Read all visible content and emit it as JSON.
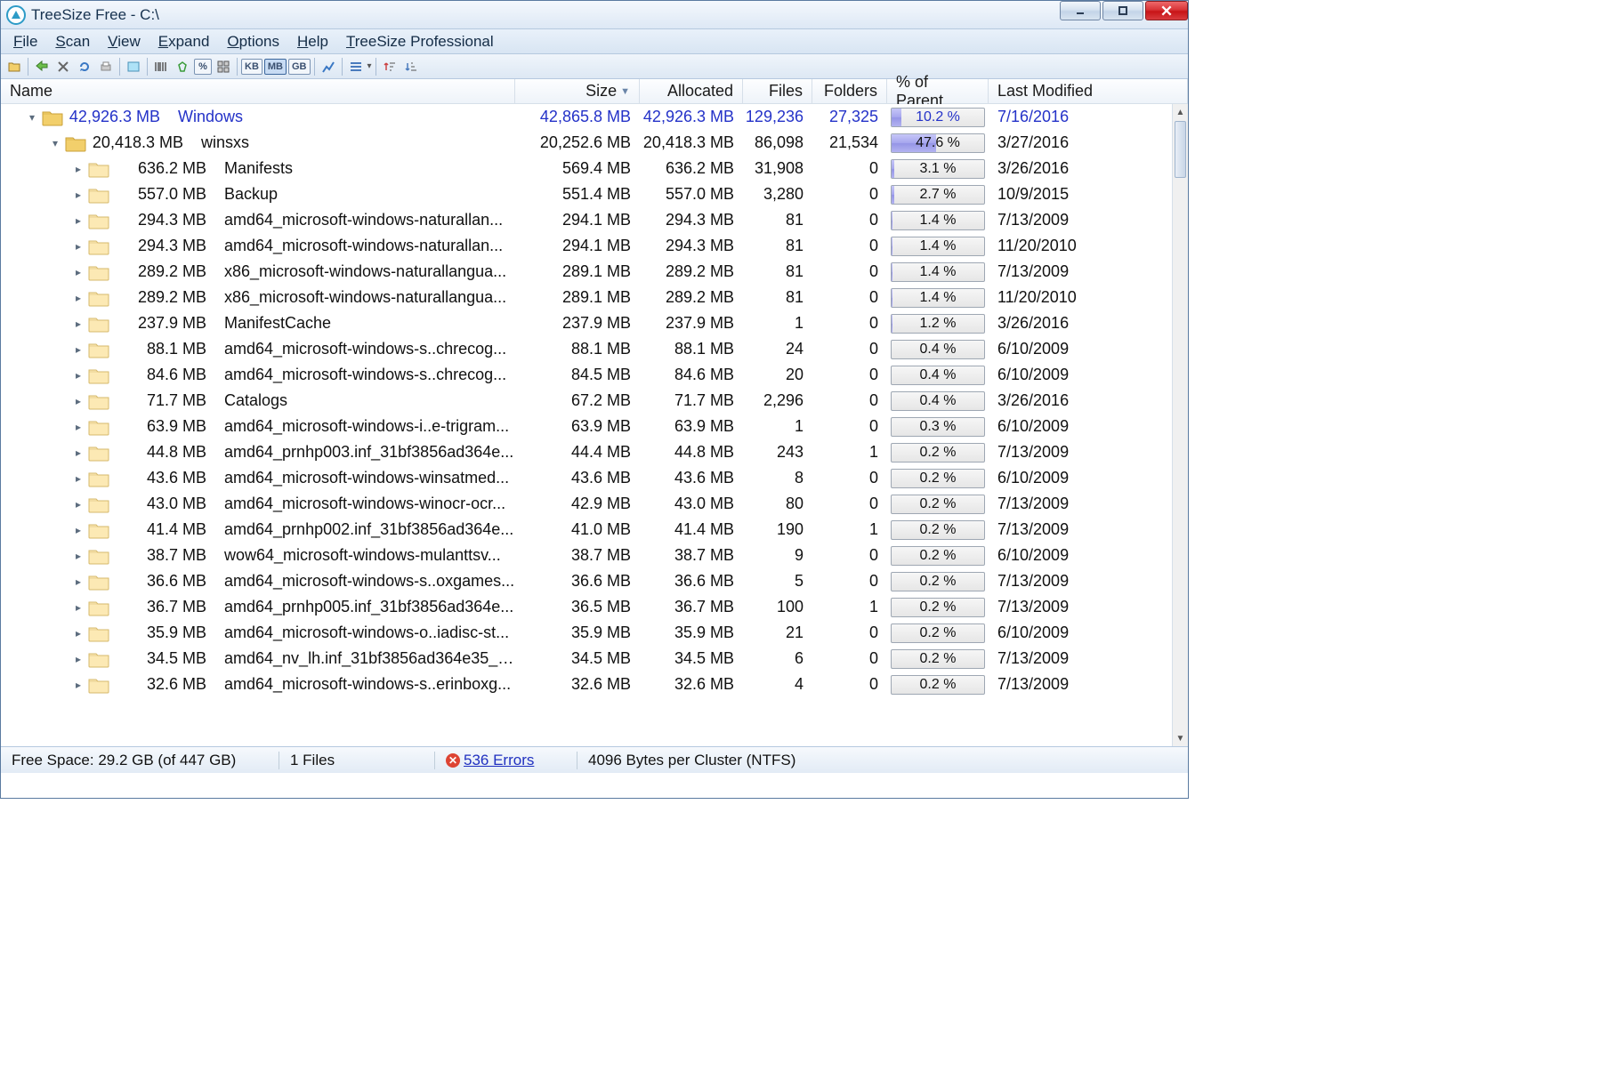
{
  "window": {
    "title": "TreeSize Free - C:\\"
  },
  "menu": {
    "items": [
      {
        "label": "File",
        "u": "F"
      },
      {
        "label": "Scan",
        "u": "S"
      },
      {
        "label": "View",
        "u": "V"
      },
      {
        "label": "Expand",
        "u": "E"
      },
      {
        "label": "Options",
        "u": "O"
      },
      {
        "label": "Help",
        "u": "H"
      },
      {
        "label": "TreeSize Professional",
        "u": "T"
      }
    ]
  },
  "toolbar": {
    "units": [
      {
        "label": "KB",
        "active": false
      },
      {
        "label": "MB",
        "active": true
      },
      {
        "label": "GB",
        "active": false
      }
    ],
    "pct_label": "%"
  },
  "columns": {
    "name": "Name",
    "size": "Size",
    "allocated": "Allocated",
    "files": "Files",
    "folders": "Folders",
    "pct": "% of Parent...",
    "modified": "Last Modified"
  },
  "rows": [
    {
      "indent": 28,
      "exp": "▾",
      "gold": true,
      "blue": true,
      "sizeL": "42,926.3 MB",
      "name": "Windows",
      "size": "42,865.8 MB",
      "alloc": "42,926.3 MB",
      "files": "129,236",
      "fold": "27,325",
      "pct": "10.2 %",
      "pctv": 10.2,
      "mod": "7/16/2016"
    },
    {
      "indent": 54,
      "exp": "▾",
      "gold": true,
      "blue": false,
      "sizeL": "20,418.3 MB",
      "name": "winsxs",
      "size": "20,252.6 MB",
      "alloc": "20,418.3 MB",
      "files": "86,098",
      "fold": "21,534",
      "pct": "47.6 %",
      "pctv": 47.6,
      "mod": "3/27/2016"
    },
    {
      "indent": 80,
      "exp": "▸",
      "gold": false,
      "blue": false,
      "sizeL": "636.2 MB",
      "name": "Manifests",
      "size": "569.4 MB",
      "alloc": "636.2 MB",
      "files": "31,908",
      "fold": "0",
      "pct": "3.1 %",
      "pctv": 3.1,
      "mod": "3/26/2016"
    },
    {
      "indent": 80,
      "exp": "▸",
      "gold": false,
      "blue": false,
      "sizeL": "557.0 MB",
      "name": "Backup",
      "size": "551.4 MB",
      "alloc": "557.0 MB",
      "files": "3,280",
      "fold": "0",
      "pct": "2.7 %",
      "pctv": 2.7,
      "mod": "10/9/2015"
    },
    {
      "indent": 80,
      "exp": "▸",
      "gold": false,
      "blue": false,
      "sizeL": "294.3 MB",
      "name": "amd64_microsoft-windows-naturallan...",
      "size": "294.1 MB",
      "alloc": "294.3 MB",
      "files": "81",
      "fold": "0",
      "pct": "1.4 %",
      "pctv": 1.4,
      "mod": "7/13/2009"
    },
    {
      "indent": 80,
      "exp": "▸",
      "gold": false,
      "blue": false,
      "sizeL": "294.3 MB",
      "name": "amd64_microsoft-windows-naturallan...",
      "size": "294.1 MB",
      "alloc": "294.3 MB",
      "files": "81",
      "fold": "0",
      "pct": "1.4 %",
      "pctv": 1.4,
      "mod": "11/20/2010"
    },
    {
      "indent": 80,
      "exp": "▸",
      "gold": false,
      "blue": false,
      "sizeL": "289.2 MB",
      "name": "x86_microsoft-windows-naturallangua...",
      "size": "289.1 MB",
      "alloc": "289.2 MB",
      "files": "81",
      "fold": "0",
      "pct": "1.4 %",
      "pctv": 1.4,
      "mod": "7/13/2009"
    },
    {
      "indent": 80,
      "exp": "▸",
      "gold": false,
      "blue": false,
      "sizeL": "289.2 MB",
      "name": "x86_microsoft-windows-naturallangua...",
      "size": "289.1 MB",
      "alloc": "289.2 MB",
      "files": "81",
      "fold": "0",
      "pct": "1.4 %",
      "pctv": 1.4,
      "mod": "11/20/2010"
    },
    {
      "indent": 80,
      "exp": "▸",
      "gold": false,
      "blue": false,
      "sizeL": "237.9 MB",
      "name": "ManifestCache",
      "size": "237.9 MB",
      "alloc": "237.9 MB",
      "files": "1",
      "fold": "0",
      "pct": "1.2 %",
      "pctv": 1.2,
      "mod": "3/26/2016"
    },
    {
      "indent": 80,
      "exp": "▸",
      "gold": false,
      "blue": false,
      "sizeL": "88.1 MB",
      "name": "amd64_microsoft-windows-s..chrecog...",
      "size": "88.1 MB",
      "alloc": "88.1 MB",
      "files": "24",
      "fold": "0",
      "pct": "0.4 %",
      "pctv": 0.4,
      "mod": "6/10/2009"
    },
    {
      "indent": 80,
      "exp": "▸",
      "gold": false,
      "blue": false,
      "sizeL": "84.6 MB",
      "name": "amd64_microsoft-windows-s..chrecog...",
      "size": "84.5 MB",
      "alloc": "84.6 MB",
      "files": "20",
      "fold": "0",
      "pct": "0.4 %",
      "pctv": 0.4,
      "mod": "6/10/2009"
    },
    {
      "indent": 80,
      "exp": "▸",
      "gold": false,
      "blue": false,
      "sizeL": "71.7 MB",
      "name": "Catalogs",
      "size": "67.2 MB",
      "alloc": "71.7 MB",
      "files": "2,296",
      "fold": "0",
      "pct": "0.4 %",
      "pctv": 0.4,
      "mod": "3/26/2016"
    },
    {
      "indent": 80,
      "exp": "▸",
      "gold": false,
      "blue": false,
      "sizeL": "63.9 MB",
      "name": "amd64_microsoft-windows-i..e-trigram...",
      "size": "63.9 MB",
      "alloc": "63.9 MB",
      "files": "1",
      "fold": "0",
      "pct": "0.3 %",
      "pctv": 0.3,
      "mod": "6/10/2009"
    },
    {
      "indent": 80,
      "exp": "▸",
      "gold": false,
      "blue": false,
      "sizeL": "44.8 MB",
      "name": "amd64_prnhp003.inf_31bf3856ad364e...",
      "size": "44.4 MB",
      "alloc": "44.8 MB",
      "files": "243",
      "fold": "1",
      "pct": "0.2 %",
      "pctv": 0.2,
      "mod": "7/13/2009"
    },
    {
      "indent": 80,
      "exp": "▸",
      "gold": false,
      "blue": false,
      "sizeL": "43.6 MB",
      "name": "amd64_microsoft-windows-winsatmed...",
      "size": "43.6 MB",
      "alloc": "43.6 MB",
      "files": "8",
      "fold": "0",
      "pct": "0.2 %",
      "pctv": 0.2,
      "mod": "6/10/2009"
    },
    {
      "indent": 80,
      "exp": "▸",
      "gold": false,
      "blue": false,
      "sizeL": "43.0 MB",
      "name": "amd64_microsoft-windows-winocr-ocr...",
      "size": "42.9 MB",
      "alloc": "43.0 MB",
      "files": "80",
      "fold": "0",
      "pct": "0.2 %",
      "pctv": 0.2,
      "mod": "7/13/2009"
    },
    {
      "indent": 80,
      "exp": "▸",
      "gold": false,
      "blue": false,
      "sizeL": "41.4 MB",
      "name": "amd64_prnhp002.inf_31bf3856ad364e...",
      "size": "41.0 MB",
      "alloc": "41.4 MB",
      "files": "190",
      "fold": "1",
      "pct": "0.2 %",
      "pctv": 0.2,
      "mod": "7/13/2009"
    },
    {
      "indent": 80,
      "exp": "▸",
      "gold": false,
      "blue": false,
      "sizeL": "38.7 MB",
      "name": "wow64_microsoft-windows-mulanttsv...",
      "size": "38.7 MB",
      "alloc": "38.7 MB",
      "files": "9",
      "fold": "0",
      "pct": "0.2 %",
      "pctv": 0.2,
      "mod": "6/10/2009"
    },
    {
      "indent": 80,
      "exp": "▸",
      "gold": false,
      "blue": false,
      "sizeL": "36.6 MB",
      "name": "amd64_microsoft-windows-s..oxgames...",
      "size": "36.6 MB",
      "alloc": "36.6 MB",
      "files": "5",
      "fold": "0",
      "pct": "0.2 %",
      "pctv": 0.2,
      "mod": "7/13/2009"
    },
    {
      "indent": 80,
      "exp": "▸",
      "gold": false,
      "blue": false,
      "sizeL": "36.7 MB",
      "name": "amd64_prnhp005.inf_31bf3856ad364e...",
      "size": "36.5 MB",
      "alloc": "36.7 MB",
      "files": "100",
      "fold": "1",
      "pct": "0.2 %",
      "pctv": 0.2,
      "mod": "7/13/2009"
    },
    {
      "indent": 80,
      "exp": "▸",
      "gold": false,
      "blue": false,
      "sizeL": "35.9 MB",
      "name": "amd64_microsoft-windows-o..iadisc-st...",
      "size": "35.9 MB",
      "alloc": "35.9 MB",
      "files": "21",
      "fold": "0",
      "pct": "0.2 %",
      "pctv": 0.2,
      "mod": "6/10/2009"
    },
    {
      "indent": 80,
      "exp": "▸",
      "gold": false,
      "blue": false,
      "sizeL": "34.5 MB",
      "name": "amd64_nv_lh.inf_31bf3856ad364e35_6...",
      "size": "34.5 MB",
      "alloc": "34.5 MB",
      "files": "6",
      "fold": "0",
      "pct": "0.2 %",
      "pctv": 0.2,
      "mod": "7/13/2009"
    },
    {
      "indent": 80,
      "exp": "▸",
      "gold": false,
      "blue": false,
      "sizeL": "32.6 MB",
      "name": "amd64_microsoft-windows-s..erinboxg...",
      "size": "32.6 MB",
      "alloc": "32.6 MB",
      "files": "4",
      "fold": "0",
      "pct": "0.2 %",
      "pctv": 0.2,
      "mod": "7/13/2009"
    }
  ],
  "status": {
    "free": "Free Space: 29.2 GB  (of 447 GB)",
    "files": "1  Files",
    "errors": "536 Errors",
    "cluster": "4096  Bytes per Cluster (NTFS)"
  }
}
